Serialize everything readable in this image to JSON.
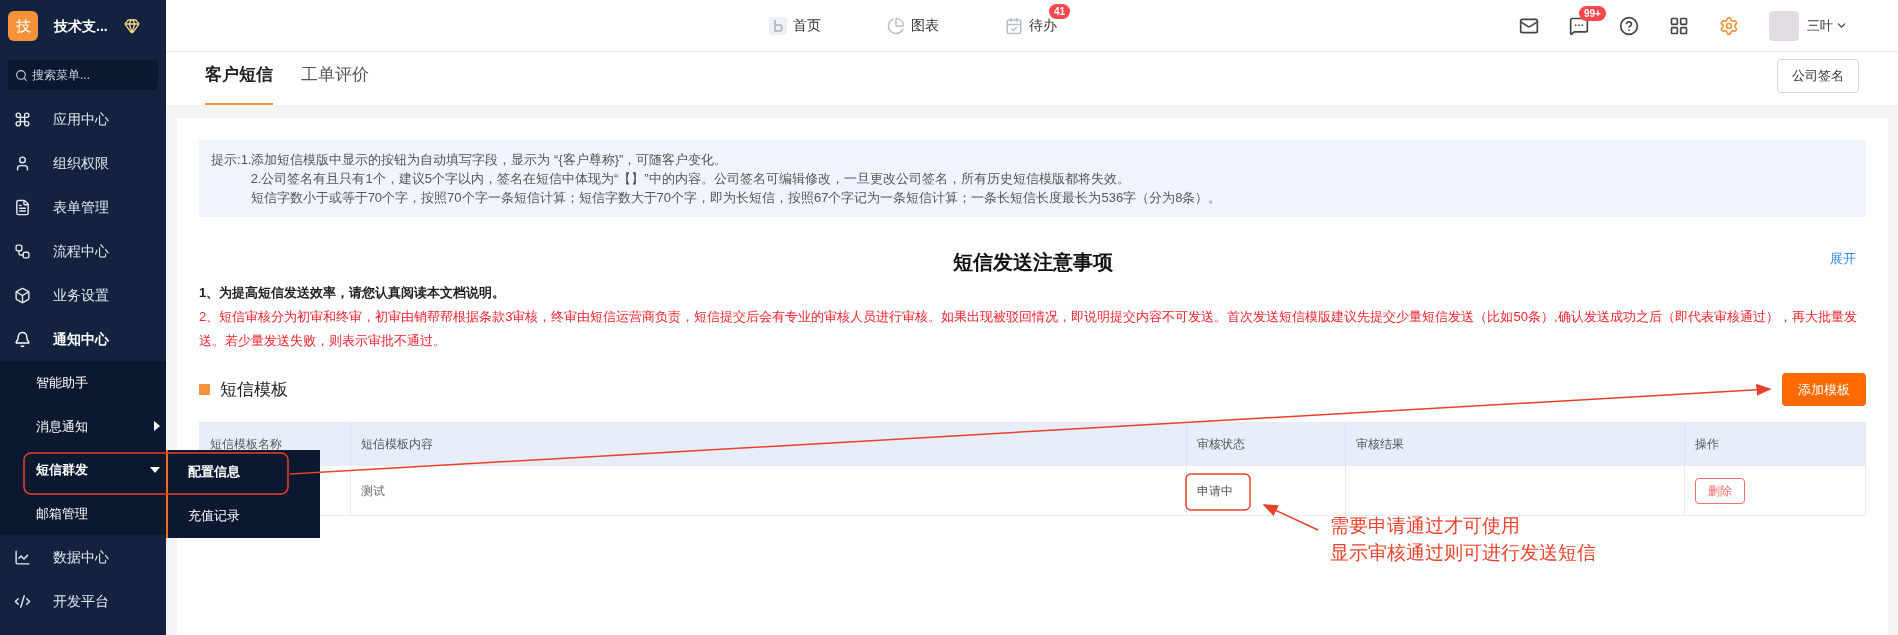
{
  "sidebar": {
    "logo_text": "技",
    "org_name": "技术支...",
    "search": {
      "placeholder": "搜索菜单..."
    },
    "items": [
      {
        "label": "应用中心",
        "expanded": false
      },
      {
        "label": "组织权限",
        "expanded": false
      },
      {
        "label": "表单管理",
        "expanded": false
      },
      {
        "label": "流程中心",
        "expanded": false
      },
      {
        "label": "业务设置",
        "expanded": false
      },
      {
        "label": "通知中心",
        "expanded": true,
        "children": [
          {
            "label": "智能助手"
          },
          {
            "label": "消息通知",
            "expanded": false
          },
          {
            "label": "短信群发",
            "expanded": true,
            "children": [
              {
                "label": "配置信息",
                "selected": true
              },
              {
                "label": "充值记录",
                "selected": false
              }
            ]
          },
          {
            "label": "邮箱管理"
          }
        ]
      },
      {
        "label": "数据中心",
        "expanded": false
      },
      {
        "label": "开发平台",
        "expanded": false
      }
    ]
  },
  "topbar": {
    "nav": [
      {
        "label": "首页"
      },
      {
        "label": "图表"
      },
      {
        "label": "待办",
        "badge": "41"
      }
    ],
    "messages_badge": "99+",
    "user_name": "三叶"
  },
  "tabs": [
    {
      "label": "客户短信",
      "selected": true
    },
    {
      "label": "工单评价",
      "selected": false
    }
  ],
  "company_sign_button": "公司签名",
  "hint": {
    "label": "提示:",
    "lines": [
      "1.添加短信模版中显示的按钮为自动填写字段，显示为 “{客户尊称}”，可随客户变化。",
      "2.公司签名有且只有1个，建议5个字以内，签名在短信中体现为“【】”中的内容。公司签名可编辑修改，一旦更改公司签名，所有历史短信模版都将失效。",
      "短信字数小于或等于70个字，按照70个字一条短信计算；短信字数大于70个字，即为长短信，按照67个字记为一条短信计算；一条长短信长度最长为536字（分为8条）。"
    ]
  },
  "notice": {
    "title": "短信发送注意事项",
    "expand_link": "展开",
    "paragraphs": [
      {
        "kind": "normal",
        "text": "1、为提高短信发送效率，请您认真阅读本文档说明。"
      },
      {
        "kind": "warning",
        "text": "2、短信审核分为初审和终审，初审由销帮帮根据条款3审核，终审由短信运营商负责，短信提交后会有专业的审核人员进行审核。如果出现被驳回情况，即说明提交内容不可发送。首次发送短信模版建议先提交少量短信发送（比如50条）,确认发送成功之后（即代表审核通过），再大批量发送。若少量发送失败，则表示审批不通过。"
      }
    ]
  },
  "templates": {
    "title": "短信模板",
    "add_button": "添加模板",
    "columns": [
      "短信模板名称",
      "短信模板内容",
      "审核状态",
      "审核结果",
      "操作"
    ],
    "rows": [
      {
        "content": "测试",
        "status": "申请中",
        "action": "删除"
      }
    ]
  },
  "annotation": {
    "note_lines": [
      "需要申请通过才可使用",
      "显示审核通过则可进行发送短信"
    ]
  }
}
